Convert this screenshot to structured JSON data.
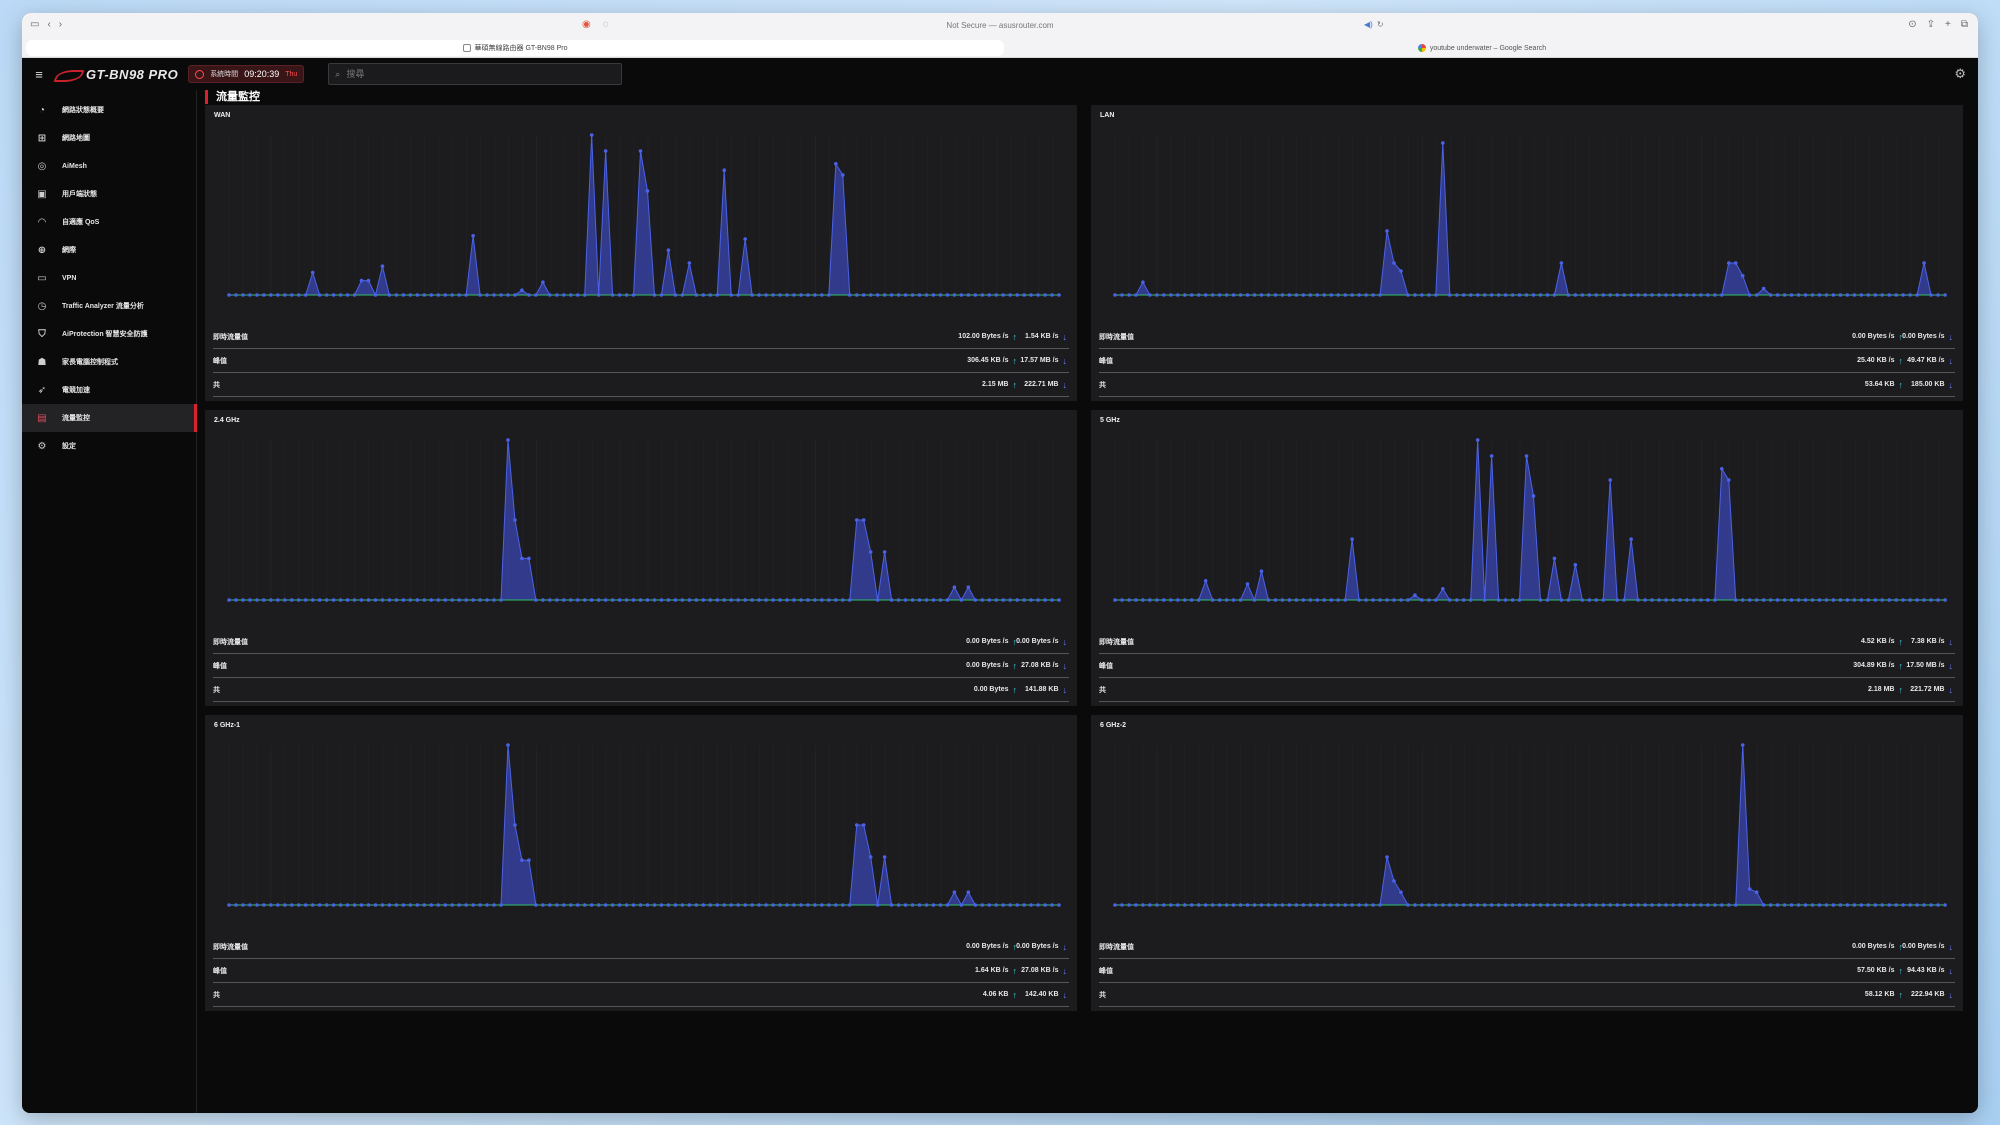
{
  "browser": {
    "url": "Not Secure — asusrouter.com",
    "tabs": [
      {
        "label": "華碩無線路由器 GT-BN98 Pro",
        "active": true
      },
      {
        "label": "youtube underwater – Google Search",
        "active": false
      }
    ]
  },
  "header": {
    "product": "GT-BN98 PRO",
    "clock_label": "系統時間",
    "time": "09:20:39",
    "day": "Thu",
    "search_placeholder": "搜尋"
  },
  "sidebar": {
    "items": [
      {
        "label": "網路狀態概要",
        "icon": "dashboard-icon"
      },
      {
        "label": "網路地圖",
        "icon": "network-map-icon"
      },
      {
        "label": "AiMesh",
        "icon": "aimesh-icon"
      },
      {
        "label": "用戶端狀態",
        "icon": "clients-icon"
      },
      {
        "label": "自適應 QoS",
        "icon": "qos-icon"
      },
      {
        "label": "網際",
        "icon": "globe-icon"
      },
      {
        "label": "VPN",
        "icon": "vpn-icon"
      },
      {
        "label": "Traffic Analyzer 流量分析",
        "icon": "traffic-analyzer-icon"
      },
      {
        "label": "AiProtection 智慧安全防護",
        "icon": "shield-icon"
      },
      {
        "label": "家長電腦控制程式",
        "icon": "parental-icon"
      },
      {
        "label": "電競加速",
        "icon": "game-boost-icon"
      },
      {
        "label": "流量監控",
        "icon": "traffic-monitor-icon",
        "active": true
      },
      {
        "label": "設定",
        "icon": "settings-icon"
      }
    ]
  },
  "page": {
    "title": "流量監控"
  },
  "stat_labels": {
    "realtime": "即時流量值",
    "peak": "峰值",
    "total": "共"
  },
  "colors": {
    "accent": "#d8232f",
    "area": "#3a46b0",
    "line": "#4a62e8",
    "green": "#2fbf6a",
    "cyan": "#3fd0e0"
  },
  "cards": [
    {
      "title": "WAN",
      "stats": {
        "realtime": {
          "up": "102.00 Bytes /s",
          "down": "1.54 KB /s"
        },
        "peak": {
          "up": "306.45 KB /s",
          "down": "17.57 MB /s"
        },
        "total": {
          "up": "2.15 MB",
          "down": "222.71 MB"
        }
      }
    },
    {
      "title": "LAN",
      "stats": {
        "realtime": {
          "up": "0.00 Bytes /s",
          "down": "0.00 Bytes /s"
        },
        "peak": {
          "up": "25.40 KB /s",
          "down": "49.47 KB /s"
        },
        "total": {
          "up": "53.64 KB",
          "down": "185.00 KB"
        }
      }
    },
    {
      "title": "2.4 GHz",
      "stats": {
        "realtime": {
          "up": "0.00 Bytes /s",
          "down": "0.00 Bytes /s"
        },
        "peak": {
          "up": "0.00 Bytes /s",
          "down": "27.08 KB /s"
        },
        "total": {
          "up": "0.00 Bytes",
          "down": "141.88 KB"
        }
      }
    },
    {
      "title": "5 GHz",
      "stats": {
        "realtime": {
          "up": "4.52 KB /s",
          "down": "7.38 KB /s"
        },
        "peak": {
          "up": "304.89 KB /s",
          "down": "17.50 MB /s"
        },
        "total": {
          "up": "2.18 MB",
          "down": "221.72 MB"
        }
      }
    },
    {
      "title": "6 GHz-1",
      "stats": {
        "realtime": {
          "up": "0.00 Bytes /s",
          "down": "0.00 Bytes /s"
        },
        "peak": {
          "up": "1.64 KB /s",
          "down": "27.08 KB /s"
        },
        "total": {
          "up": "4.06 KB",
          "down": "142.40 KB"
        }
      }
    },
    {
      "title": "6 GHz-2",
      "stats": {
        "realtime": {
          "up": "0.00 Bytes /s",
          "down": "0.00 Bytes /s"
        },
        "peak": {
          "up": "57.50 KB /s",
          "down": "94.43 KB /s"
        },
        "total": {
          "up": "58.12 KB",
          "down": "222.94 KB"
        }
      }
    }
  ],
  "chart_data": [
    {
      "type": "area",
      "title": "WAN",
      "points": 120,
      "peaks": [
        [
          12,
          0.14
        ],
        [
          19,
          0.09
        ],
        [
          20,
          0.09
        ],
        [
          22,
          0.18
        ],
        [
          35,
          0.37
        ],
        [
          42,
          0.03
        ],
        [
          45,
          0.08
        ],
        [
          52,
          1.0
        ],
        [
          54,
          0.9
        ],
        [
          59,
          0.9
        ],
        [
          60,
          0.65
        ],
        [
          63,
          0.28
        ],
        [
          66,
          0.2
        ],
        [
          71,
          0.78
        ],
        [
          74,
          0.35
        ],
        [
          87,
          0.82
        ],
        [
          88,
          0.75
        ]
      ]
    },
    {
      "type": "area",
      "title": "LAN",
      "points": 120,
      "peaks": [
        [
          4,
          0.08
        ],
        [
          39,
          0.4
        ],
        [
          40,
          0.2
        ],
        [
          41,
          0.15
        ],
        [
          47,
          0.95
        ],
        [
          64,
          0.2
        ],
        [
          88,
          0.2
        ],
        [
          89,
          0.2
        ],
        [
          90,
          0.12
        ],
        [
          93,
          0.04
        ],
        [
          116,
          0.2
        ]
      ]
    },
    {
      "type": "area",
      "title": "2.4 GHz",
      "points": 120,
      "peaks": [
        [
          40,
          1.0
        ],
        [
          41,
          0.5
        ],
        [
          42,
          0.26
        ],
        [
          43,
          0.26
        ],
        [
          90,
          0.5
        ],
        [
          91,
          0.5
        ],
        [
          92,
          0.3
        ],
        [
          94,
          0.3
        ],
        [
          104,
          0.08
        ],
        [
          106,
          0.08
        ]
      ]
    },
    {
      "type": "area",
      "title": "5 GHz",
      "points": 120,
      "peaks": [
        [
          13,
          0.12
        ],
        [
          19,
          0.1
        ],
        [
          21,
          0.18
        ],
        [
          34,
          0.38
        ],
        [
          43,
          0.03
        ],
        [
          47,
          0.07
        ],
        [
          52,
          1.0
        ],
        [
          54,
          0.9
        ],
        [
          59,
          0.9
        ],
        [
          60,
          0.65
        ],
        [
          63,
          0.26
        ],
        [
          66,
          0.22
        ],
        [
          71,
          0.75
        ],
        [
          74,
          0.38
        ],
        [
          87,
          0.82
        ],
        [
          88,
          0.75
        ]
      ]
    },
    {
      "type": "area",
      "title": "6 GHz-1",
      "points": 120,
      "peaks": [
        [
          40,
          1.0
        ],
        [
          41,
          0.5
        ],
        [
          42,
          0.28
        ],
        [
          43,
          0.28
        ],
        [
          90,
          0.5
        ],
        [
          91,
          0.5
        ],
        [
          92,
          0.3
        ],
        [
          94,
          0.3
        ],
        [
          104,
          0.08
        ],
        [
          106,
          0.08
        ]
      ]
    },
    {
      "type": "area",
      "title": "6 GHz-2",
      "points": 120,
      "peaks": [
        [
          39,
          0.3
        ],
        [
          40,
          0.15
        ],
        [
          41,
          0.08
        ],
        [
          90,
          1.0
        ],
        [
          91,
          0.1
        ],
        [
          92,
          0.08
        ]
      ]
    }
  ]
}
